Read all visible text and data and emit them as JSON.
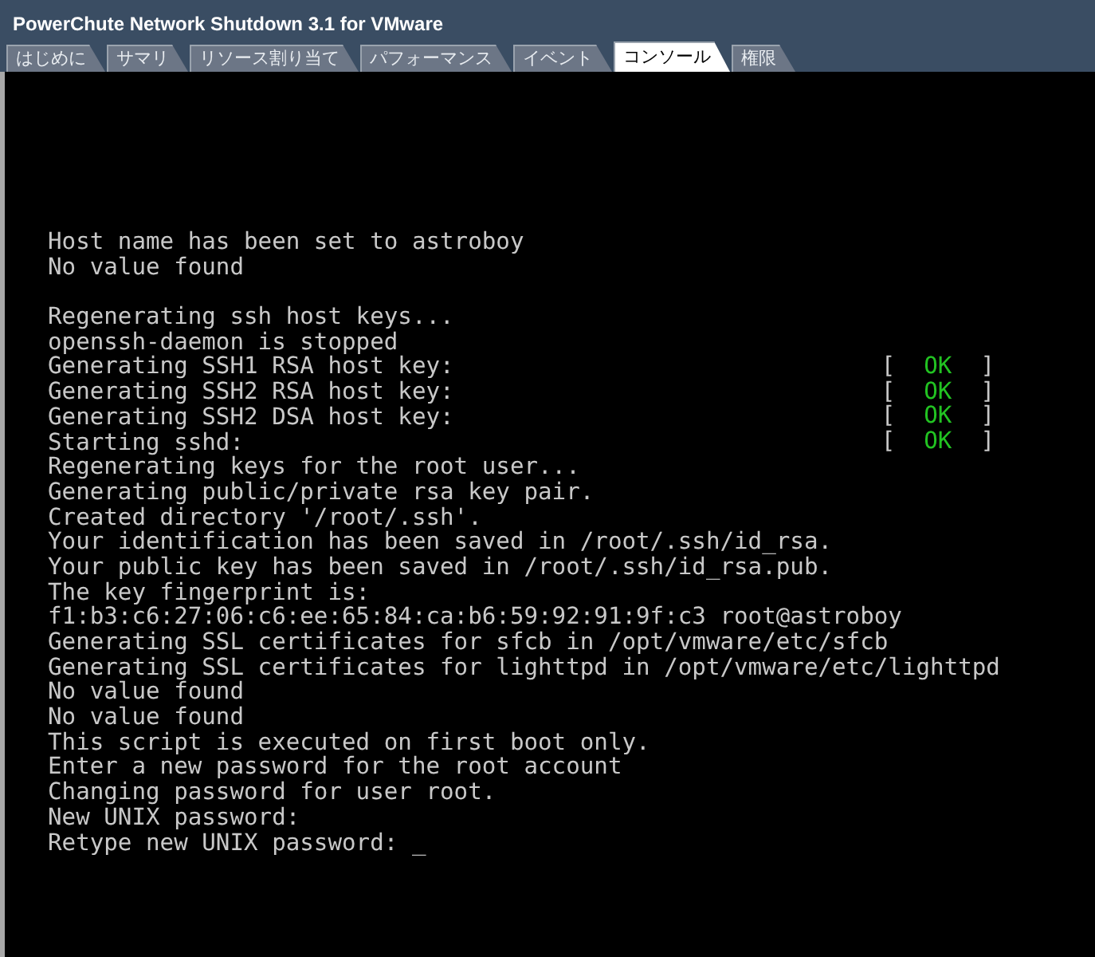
{
  "window": {
    "title": "PowerChute Network Shutdown 3.1 for VMware"
  },
  "tabs": [
    {
      "label": "はじめに",
      "selected": false
    },
    {
      "label": "サマリ",
      "selected": false
    },
    {
      "label": "リソース割り当て",
      "selected": false
    },
    {
      "label": "パフォーマンス",
      "selected": false
    },
    {
      "label": "イベント",
      "selected": false
    },
    {
      "label": "コンソール",
      "selected": true
    },
    {
      "label": "権限",
      "selected": false
    }
  ],
  "console": {
    "lines": [
      {
        "text": "Host name has been set to astroboy"
      },
      {
        "text": "No value found"
      },
      {
        "text": "Regenerating ssh host keys...",
        "gap_before": true
      },
      {
        "text": "openssh-daemon is stopped"
      },
      {
        "text": "Generating SSH1 RSA host key:",
        "open": "[",
        "status": "OK",
        "close": "]"
      },
      {
        "text": "Generating SSH2 RSA host key:",
        "open": "[",
        "status": "OK",
        "close": "]"
      },
      {
        "text": "Generating SSH2 DSA host key:",
        "open": "[",
        "status": "OK",
        "close": "]"
      },
      {
        "text": "Starting sshd:",
        "open": "[",
        "status": "OK",
        "close": "]"
      },
      {
        "text": "Regenerating keys for the root user..."
      },
      {
        "text": "Generating public/private rsa key pair."
      },
      {
        "text": "Created directory '/root/.ssh'."
      },
      {
        "text": "Your identification has been saved in /root/.ssh/id_rsa."
      },
      {
        "text": "Your public key has been saved in /root/.ssh/id_rsa.pub."
      },
      {
        "text": "The key fingerprint is:"
      },
      {
        "text": "f1:b3:c6:27:06:c6:ee:65:84:ca:b6:59:92:91:9f:c3 root@astroboy"
      },
      {
        "text": "Generating SSL certificates for sfcb in /opt/vmware/etc/sfcb"
      },
      {
        "text": "Generating SSL certificates for lighttpd in /opt/vmware/etc/lighttpd"
      },
      {
        "text": "No value found"
      },
      {
        "text": "No value found"
      },
      {
        "text": "This script is executed on first boot only."
      },
      {
        "text": "Enter a new password for the root account"
      },
      {
        "text": "Changing password for user root."
      },
      {
        "text": "New UNIX password:"
      },
      {
        "text": "Retype new UNIX password: _"
      }
    ]
  }
}
